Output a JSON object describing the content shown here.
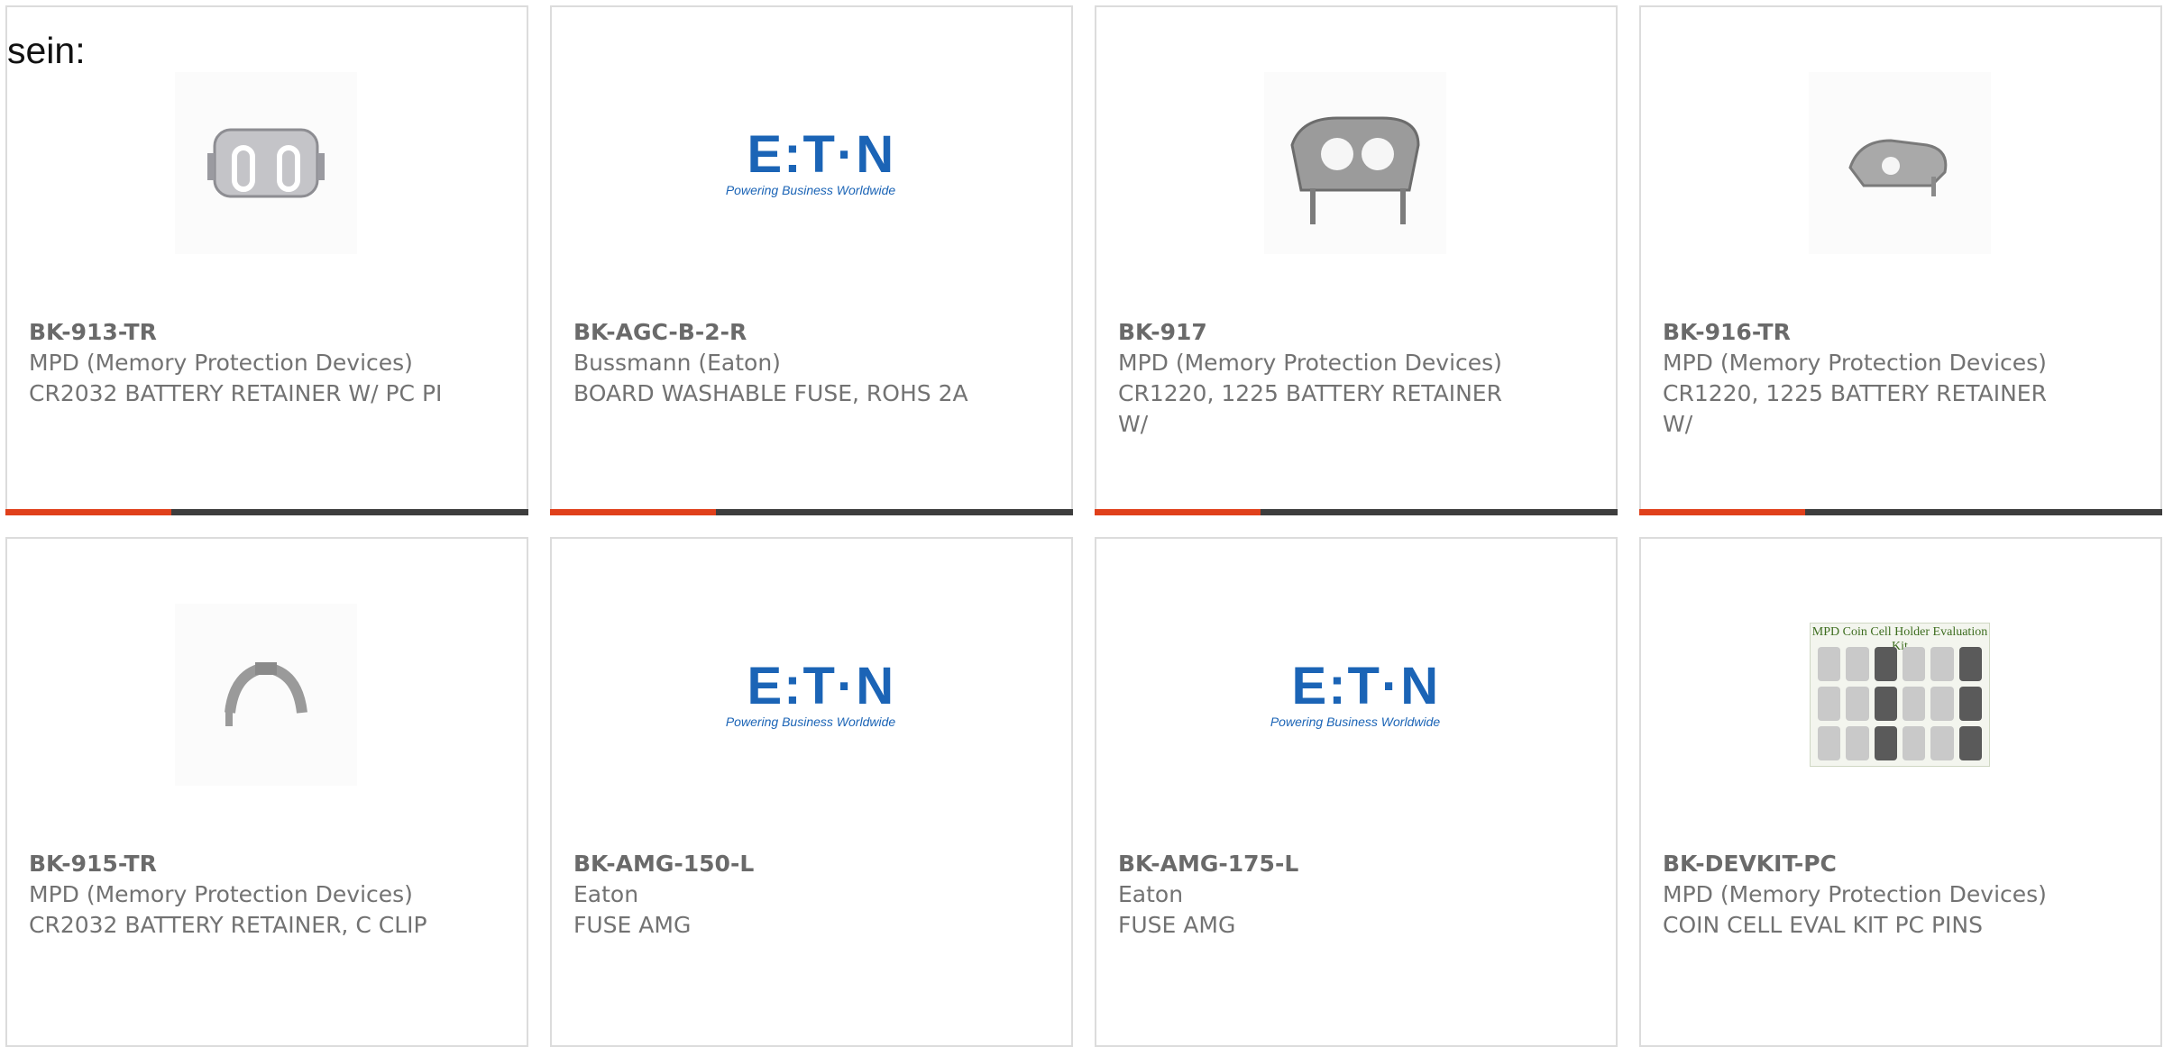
{
  "intro_text": "sein:",
  "eaton_logo": {
    "mark": "E:T·N",
    "tagline": "Powering Business Worldwide"
  },
  "kit_logo_title": "MPD Coin Cell Holder Evaluation Kit",
  "colors": {
    "accent": "#e0401b",
    "bar": "#3d3d3d",
    "text": "#727272",
    "eaton_blue": "#1b64b6"
  },
  "products": [
    {
      "part_number": "BK-913-TR",
      "manufacturer": "MPD (Memory Protection Devices)",
      "description": "CR2032 BATTERY RETAINER W/ PC PI",
      "image": "battery-retainer-913-image"
    },
    {
      "part_number": "BK-AGC-B-2-R",
      "manufacturer": "Bussmann (Eaton)",
      "description": "BOARD WASHABLE FUSE, ROHS 2A",
      "image": "eaton-logo"
    },
    {
      "part_number": "BK-917",
      "manufacturer": "MPD (Memory Protection Devices)",
      "description": "CR1220, 1225 BATTERY RETAINER W/",
      "image": "battery-retainer-917-image"
    },
    {
      "part_number": "BK-916-TR",
      "manufacturer": "MPD (Memory Protection Devices)",
      "description": "CR1220, 1225 BATTERY RETAINER W/",
      "image": "battery-retainer-916-image"
    },
    {
      "part_number": "BK-915-TR",
      "manufacturer": "MPD (Memory Protection Devices)",
      "description": "CR2032 BATTERY RETAINER, C CLIP",
      "image": "battery-clip-915-image"
    },
    {
      "part_number": "BK-AMG-150-L",
      "manufacturer": "Eaton",
      "description": "FUSE AMG",
      "image": "eaton-logo"
    },
    {
      "part_number": "BK-AMG-175-L",
      "manufacturer": "Eaton",
      "description": "FUSE AMG",
      "image": "eaton-logo"
    },
    {
      "part_number": "BK-DEVKIT-PC",
      "manufacturer": "MPD (Memory Protection Devices)",
      "description": "COIN CELL EVAL KIT PC PINS",
      "image": "coin-cell-kit-image"
    }
  ]
}
